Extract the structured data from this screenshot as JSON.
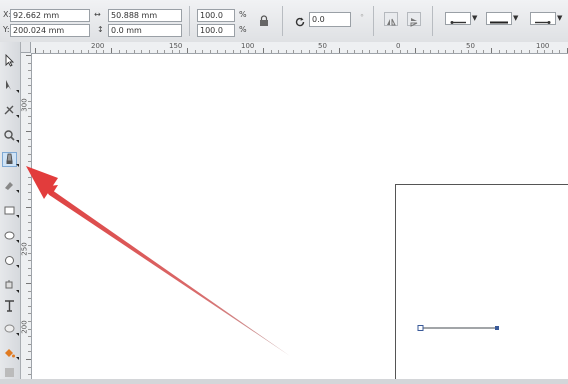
{
  "property_bar": {
    "x_label": "X:",
    "x_value": "92.662 mm",
    "y_label": "Y:",
    "y_value": "200.024 mm",
    "width_value": "50.888 mm",
    "height_value": "0.0 mm",
    "scale_w": "100.0",
    "scale_h": "100.0",
    "percent_sign": "%",
    "rotation_value": "0.0"
  },
  "ruler_horizontal": {
    "labels": [
      "200",
      "150",
      "100",
      "50",
      "0",
      "50",
      "100"
    ]
  },
  "ruler_vertical": {
    "labels": [
      "300",
      "250",
      "200"
    ]
  },
  "icons": {
    "lock": "lock-ratio-icon",
    "rotate": "rotate-icon",
    "mirror_h": "mirror-horizontal-icon",
    "mirror_v": "mirror-vertical-icon",
    "start_arrow": "start-arrowhead-icon",
    "line_style": "line-style-icon",
    "end_arrow": "end-arrowhead-icon"
  },
  "colors": {
    "annotation_arrow": "#e05050",
    "selection_node": "#3a5a99",
    "active_tool": "#cfe3f6"
  }
}
